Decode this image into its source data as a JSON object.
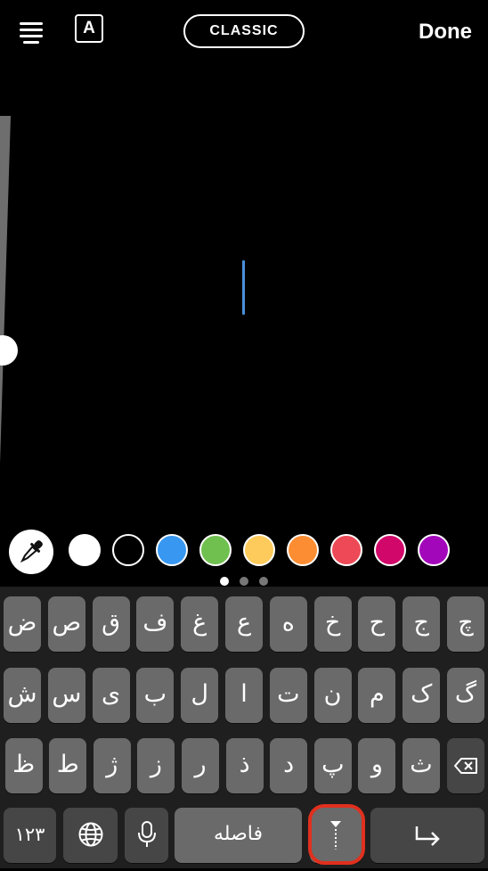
{
  "top_bar": {
    "text_style_label": "A",
    "font_name": "CLASSIC",
    "done_label": "Done"
  },
  "colors": {
    "caret": "#4a90d9",
    "swatches": [
      "#ffffff",
      "#000000",
      "#3897f0",
      "#70c050",
      "#fdcb5c",
      "#fd8d32",
      "#ed4956",
      "#d10869",
      "#a307ba"
    ]
  },
  "pager": {
    "pages": 3,
    "active": 1
  },
  "keyboard": {
    "row1": [
      "چ",
      "ج",
      "ح",
      "خ",
      "ه",
      "ع",
      "غ",
      "ف",
      "ق",
      "ص",
      "ض"
    ],
    "row2": [
      "گ",
      "ک",
      "م",
      "ن",
      "ت",
      "ا",
      "ل",
      "ب",
      "ی",
      "س",
      "ش"
    ],
    "row3": [
      "ث",
      "و",
      "پ",
      "د",
      "ذ",
      "ر",
      "ز",
      "ژ",
      "ط",
      "ظ"
    ],
    "numbers_label": "۱۲۳",
    "space_label": "فاصله",
    "globe_icon": "globe-icon",
    "mic_icon": "microphone-icon",
    "delete_icon": "backspace-icon",
    "return_icon": "return-icon",
    "zwnj_icon": "zero-width-non-joiner-icon"
  }
}
